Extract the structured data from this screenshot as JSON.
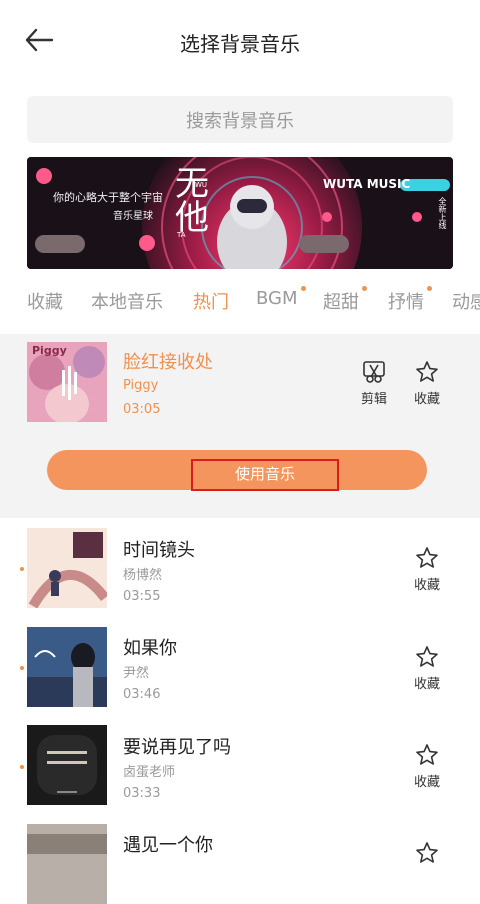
{
  "header": {
    "title": "选择背景音乐"
  },
  "search": {
    "placeholder": "搜索背景音乐"
  },
  "banner": {
    "brand": "WUTA MUSIC",
    "lyric": "你的心略大于整个宇宙",
    "sublabel": "音乐星球",
    "big_text": "无他",
    "side_label": "全新上线",
    "small_a": "WU",
    "small_b": "TA"
  },
  "tabs": [
    {
      "label": "收藏",
      "active": false,
      "dot": false
    },
    {
      "label": "本地音乐",
      "active": false,
      "dot": false
    },
    {
      "label": "热门",
      "active": true,
      "dot": false
    },
    {
      "label": "BGM",
      "active": false,
      "dot": true
    },
    {
      "label": "超甜",
      "active": false,
      "dot": true
    },
    {
      "label": "抒情",
      "active": false,
      "dot": true
    },
    {
      "label": "动感",
      "active": false,
      "dot": false
    }
  ],
  "selected_song": {
    "title": "脸红接收处",
    "artist": "Piggy",
    "duration": "03:05",
    "cover_text": "Piggy",
    "edit_label": "剪辑",
    "fav_label": "收藏",
    "use_button": "使用音乐"
  },
  "songs": [
    {
      "title": "时间镜头",
      "artist": "杨博然",
      "duration": "03:55",
      "fav_label": "收藏"
    },
    {
      "title": "如果你",
      "artist": "尹然",
      "duration": "03:46",
      "fav_label": "收藏"
    },
    {
      "title": "要说再见了吗",
      "artist": "卤蛋老师",
      "duration": "03:33",
      "fav_label": "收藏"
    },
    {
      "title": "遇见一个你",
      "artist": "",
      "duration": "",
      "fav_label": ""
    }
  ],
  "colors": {
    "accent": "#f0914e",
    "button": "#f5955e",
    "highlight_border": "#d81e1e"
  }
}
